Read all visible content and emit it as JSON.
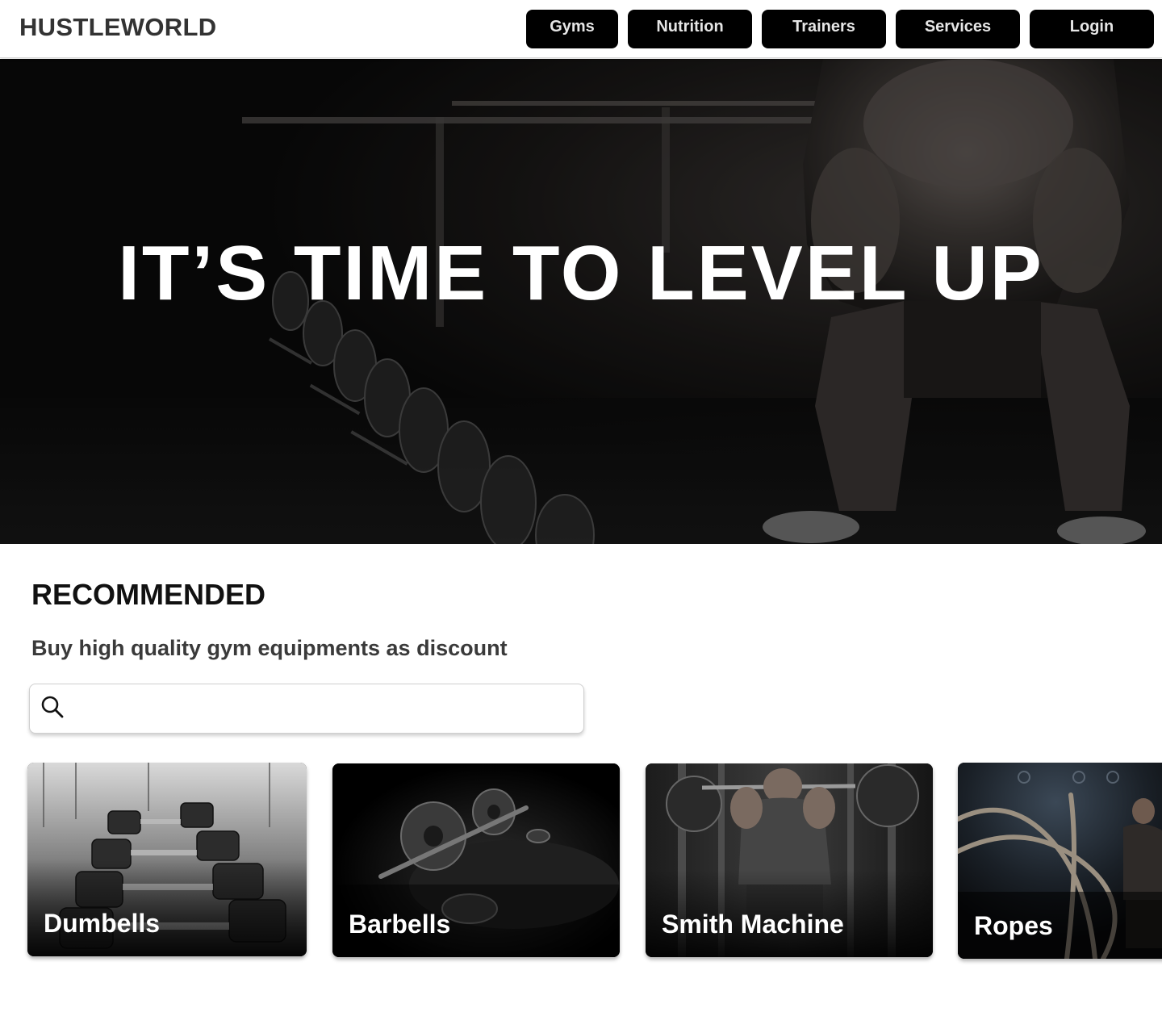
{
  "header": {
    "logo": "HUSTLEWORLD",
    "nav": [
      {
        "label": "Gyms"
      },
      {
        "label": "Nutrition"
      },
      {
        "label": "Trainers"
      },
      {
        "label": "Services"
      },
      {
        "label": "Login"
      }
    ]
  },
  "hero": {
    "title": "IT’S TIME TO LEVEL UP"
  },
  "recommended": {
    "title": "RECOMMENDED",
    "subtitle": "Buy high quality gym equipments as discount",
    "search": {
      "value": "",
      "placeholder": "",
      "icon": "search-icon"
    },
    "cards": [
      {
        "label": "Dumbells"
      },
      {
        "label": "Barbells"
      },
      {
        "label": "Smith Machine"
      },
      {
        "label": "Ropes"
      }
    ]
  },
  "colors": {
    "nav_button_bg": "#000000",
    "nav_button_text": "#e6e6e6",
    "hero_bg": "#0d0d0d",
    "heading": "#111111"
  }
}
